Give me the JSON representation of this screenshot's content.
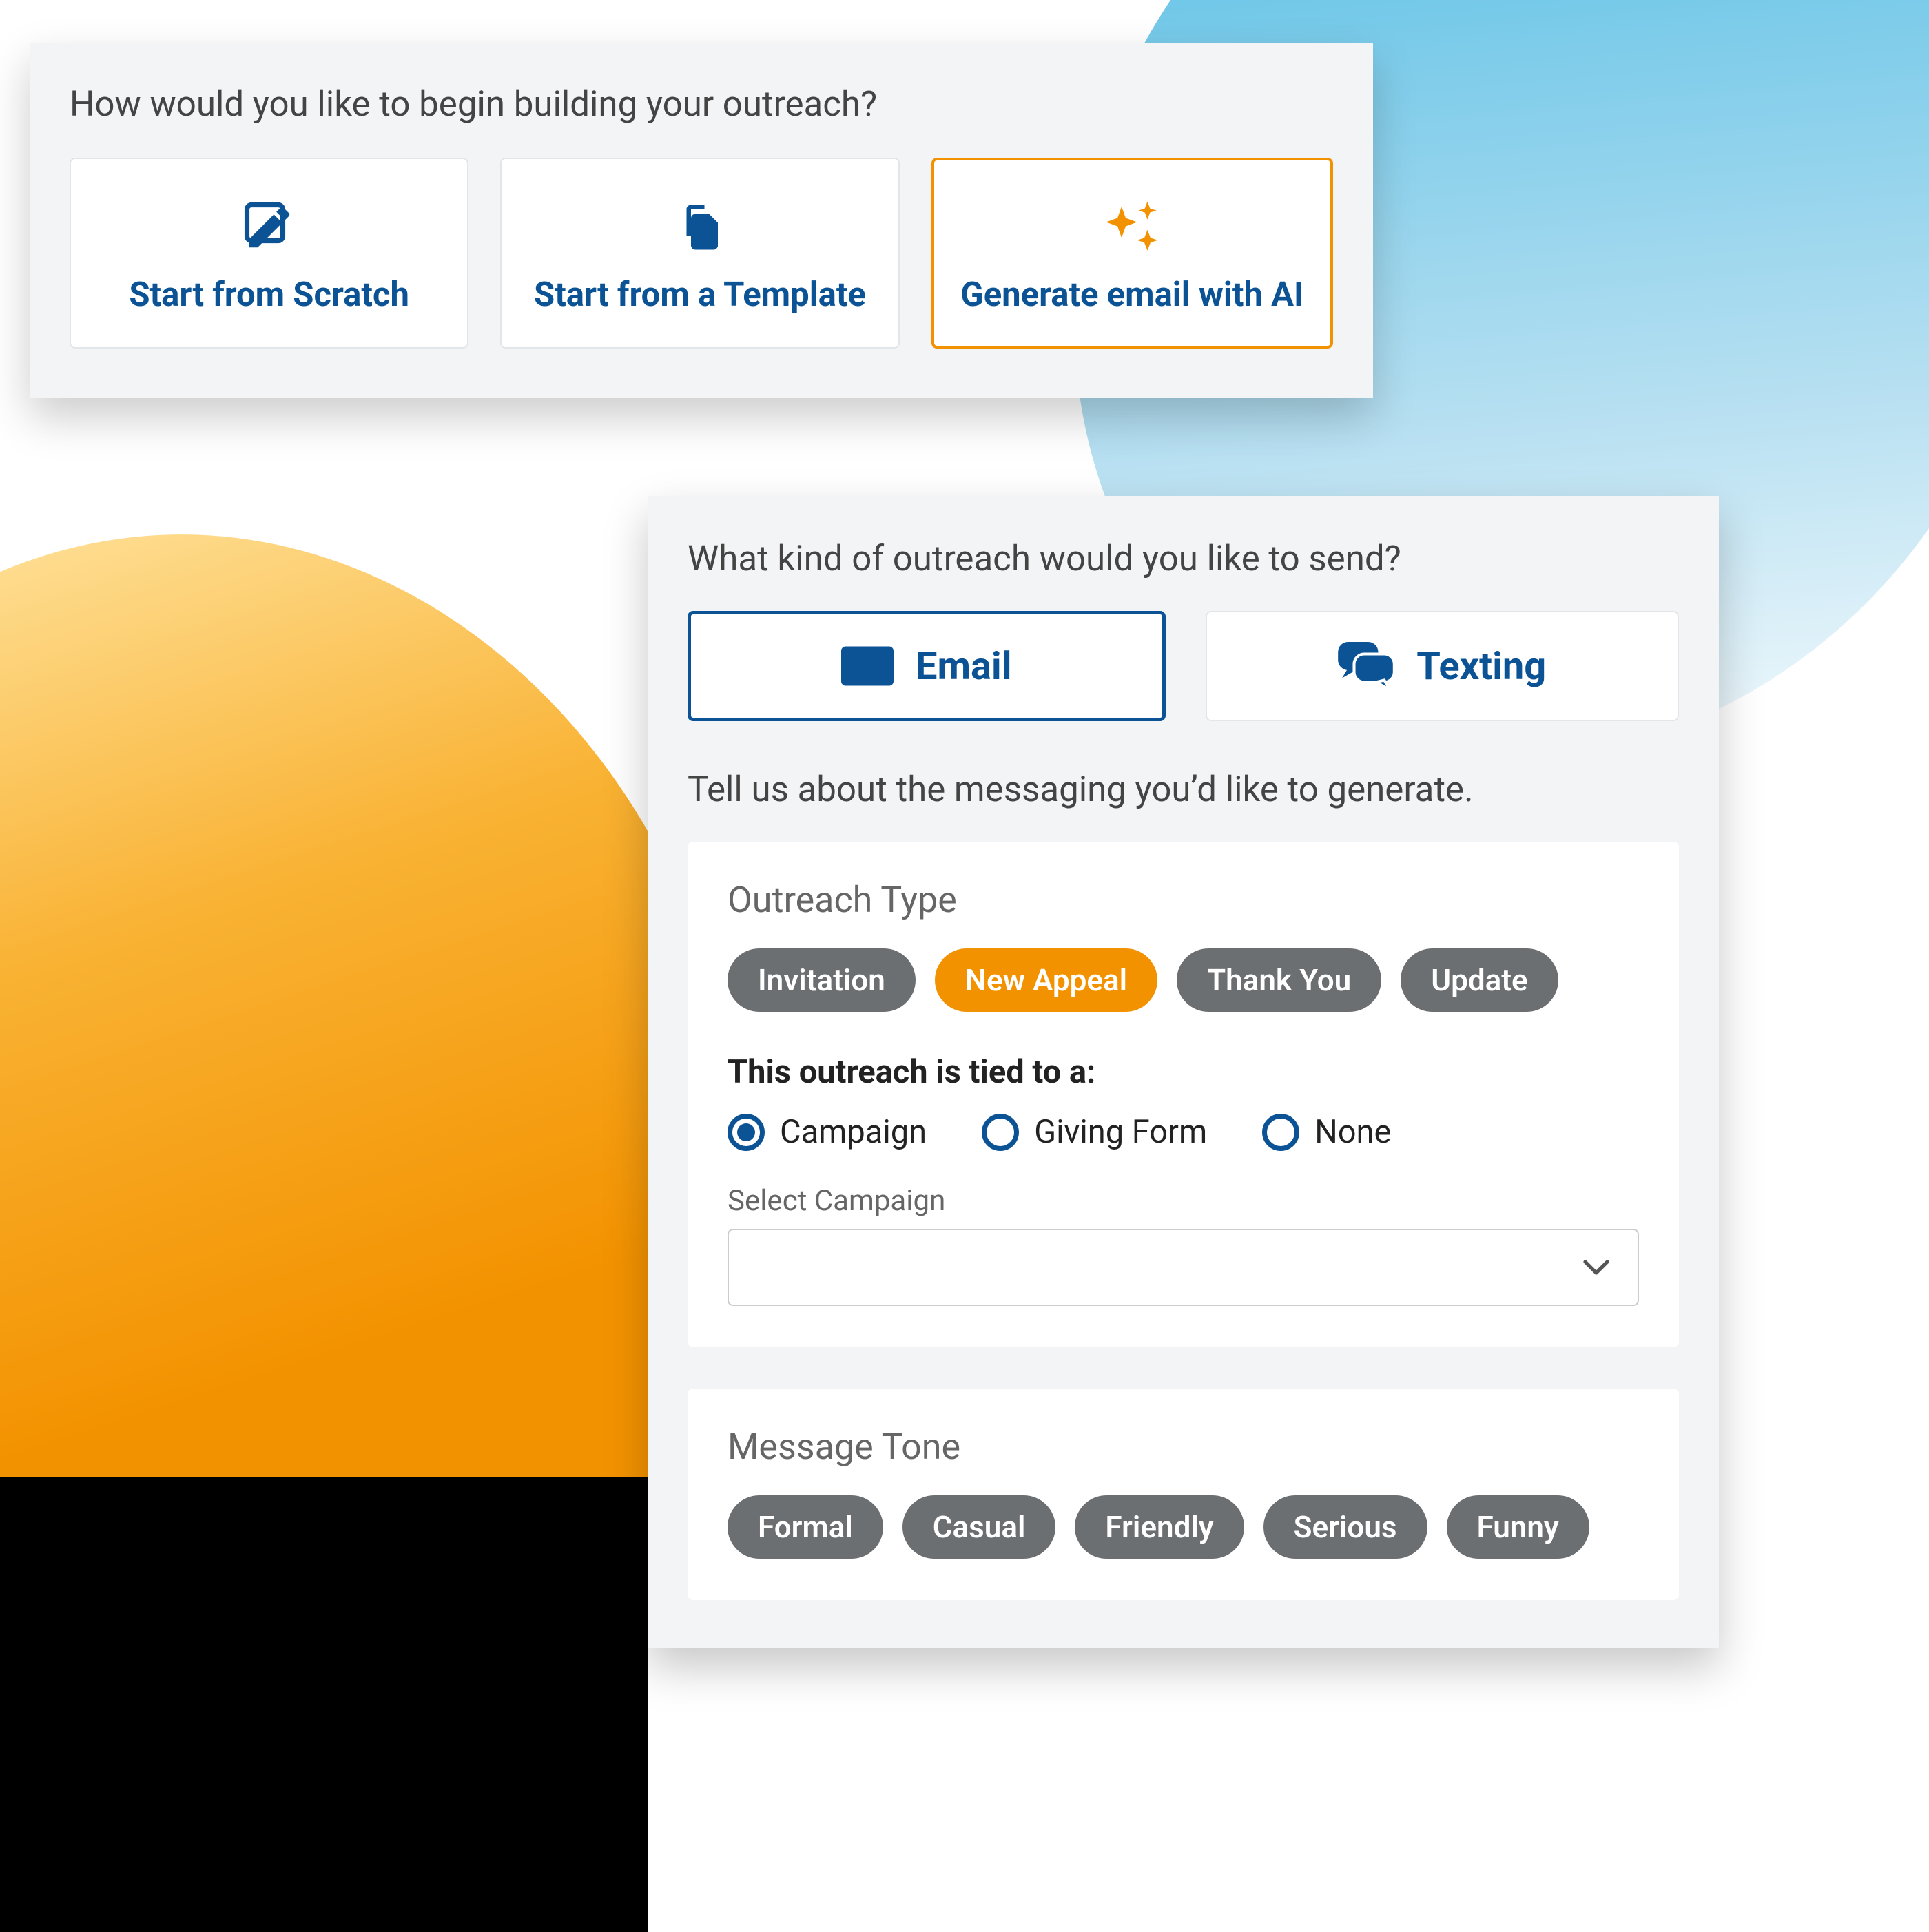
{
  "top": {
    "prompt": "How would you like to begin building your outreach?",
    "options": [
      {
        "label": "Start from Scratch",
        "icon": "edit-icon",
        "selected": false
      },
      {
        "label": "Start from a Template",
        "icon": "copy-icon",
        "selected": false
      },
      {
        "label": "Generate email with AI",
        "icon": "sparkles-icon",
        "selected": true
      }
    ]
  },
  "bottom": {
    "prompt": "What kind of outreach would you like to send?",
    "channels": [
      {
        "label": "Email",
        "icon": "envelope-icon",
        "selected": true
      },
      {
        "label": "Texting",
        "icon": "chat-icon",
        "selected": false
      }
    ],
    "subprompt": "Tell us about the messaging you’d like to generate.",
    "outreach_type": {
      "title": "Outreach Type",
      "options": [
        {
          "label": "Invitation",
          "active": false
        },
        {
          "label": "New Appeal",
          "active": true
        },
        {
          "label": "Thank You",
          "active": false
        },
        {
          "label": "Update",
          "active": false
        }
      ],
      "tied_label": "This outreach is tied to a:",
      "tied_options": [
        {
          "label": "Campaign",
          "checked": true
        },
        {
          "label": "Giving Form",
          "checked": false
        },
        {
          "label": "None",
          "checked": false
        }
      ],
      "select_label": "Select Campaign",
      "select_value": ""
    },
    "message_tone": {
      "title": "Message Tone",
      "options": [
        {
          "label": "Formal",
          "active": false
        },
        {
          "label": "Casual",
          "active": false
        },
        {
          "label": "Friendly",
          "active": false
        },
        {
          "label": "Serious",
          "active": false
        },
        {
          "label": "Funny",
          "active": false
        }
      ]
    }
  },
  "colors": {
    "brand_blue": "#0b5394",
    "brand_orange": "#f39200",
    "pill_gray": "#6b6f72"
  }
}
